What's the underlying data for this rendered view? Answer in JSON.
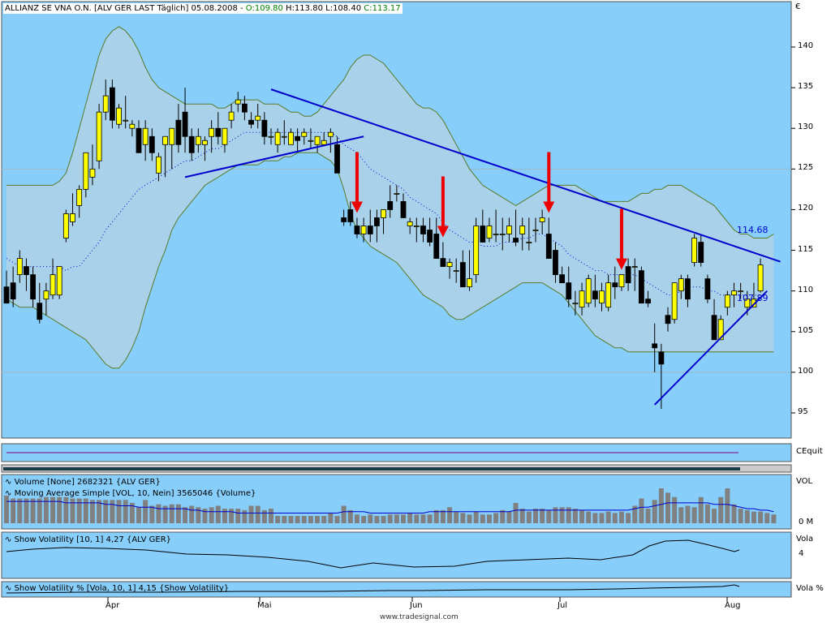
{
  "header": {
    "instrument": "ALLIANZ SE VNA O.N. [ALV GER LAST Täglich] 05.08.2008",
    "open": "O:109.80",
    "high": "H:113.80",
    "low": "L:108.40",
    "close": "C:113.17",
    "currency": "€"
  },
  "colors": {
    "background": "#87cefa",
    "band_fill": "#a9d2ea",
    "band_line": "#5a7a2a",
    "trendline": "#0000cc",
    "arrow": "#ee0000",
    "up_candle": "#ffff00",
    "down_candle": "#000000",
    "volume_bar": "#808080",
    "volume_ma": "#0000cc"
  },
  "price_panel": {
    "y_ticks": [
      "140",
      "135",
      "130",
      "125",
      "120",
      "115",
      "110",
      "105",
      "100",
      "95"
    ],
    "label_upper": "114.68",
    "label_lower": "107.89"
  },
  "cequity_panel": {
    "label": "CEquit"
  },
  "volume_panel": {
    "legend1": "Volume [None] 2682321 {ALV GER}",
    "legend2": "Moving Average Simple [VOL, 10, Nein] 3565046 {Volume}",
    "axis_label": "VOL",
    "axis_value": "0 M"
  },
  "volatility_panel": {
    "legend": "Show Volatility [10, 1] 4,27 {ALV GER}",
    "axis_label": "Vola",
    "axis_value": "4"
  },
  "volatility_pct_panel": {
    "legend": "Show Volatility % [Vola, 10, 1] 4,15 {Show Volatility}",
    "axis_label": "Vola %"
  },
  "x_axis": {
    "months": [
      "Apr",
      "Mai",
      "Jun",
      "Jul",
      "Aug"
    ]
  },
  "footer": "www.tradesignal.com",
  "chart_data": {
    "type": "candlestick",
    "title": "ALLIANZ SE VNA O.N. [ALV GER LAST Täglich] 05.08.2008",
    "ylim": [
      93,
      145
    ],
    "candles": [
      [
        110.5,
        112.5,
        108.5,
        108.5
      ],
      [
        111,
        113,
        108,
        109
      ],
      [
        112,
        115,
        111,
        114
      ],
      [
        113,
        114,
        110,
        112
      ],
      [
        112,
        113,
        108,
        109
      ],
      [
        108.5,
        111,
        106,
        106.5
      ],
      [
        109,
        111,
        107,
        110
      ],
      [
        109.5,
        114,
        109,
        112
      ],
      [
        109.5,
        113,
        109,
        113
      ],
      [
        116.5,
        120,
        116,
        119.5
      ],
      [
        118.5,
        122,
        118,
        119.5
      ],
      [
        120.5,
        123,
        119,
        122.5
      ],
      [
        122.5,
        127,
        121.5,
        127
      ],
      [
        124,
        128,
        123,
        125
      ],
      [
        126,
        133,
        125,
        132
      ],
      [
        132,
        136,
        131,
        134
      ],
      [
        135,
        136,
        130,
        131
      ],
      [
        130.5,
        133,
        130,
        132.5
      ],
      [
        131,
        134,
        130,
        131
      ],
      [
        130,
        131,
        129,
        130.5
      ],
      [
        130,
        131,
        127,
        127
      ],
      [
        128,
        131,
        126,
        130
      ],
      [
        129,
        130,
        126,
        127
      ],
      [
        124.5,
        127,
        123.5,
        126.5
      ],
      [
        128,
        129,
        124,
        129
      ],
      [
        128,
        130,
        125,
        130
      ],
      [
        131,
        133,
        127,
        128
      ],
      [
        132,
        135,
        127,
        129
      ],
      [
        129,
        130,
        126,
        127
      ],
      [
        128,
        130,
        127,
        129
      ],
      [
        128,
        129,
        126,
        128.5
      ],
      [
        129,
        131,
        127,
        130
      ],
      [
        130,
        132,
        128,
        129
      ],
      [
        128,
        130,
        127,
        130
      ],
      [
        131,
        133,
        130,
        132
      ],
      [
        133,
        134.5,
        132,
        133.5
      ],
      [
        133,
        134,
        131,
        132
      ],
      [
        131,
        132,
        130,
        130.5
      ],
      [
        131,
        133,
        130,
        131.5
      ],
      [
        131,
        132,
        128,
        129
      ],
      [
        129,
        130,
        128,
        129
      ],
      [
        128,
        130,
        127,
        129.5
      ],
      [
        129,
        131,
        128,
        129
      ],
      [
        128,
        130,
        128,
        129.5
      ],
      [
        129,
        130,
        127,
        128.5
      ],
      [
        129,
        130,
        128,
        129.5
      ],
      [
        128.5,
        130,
        127.5,
        128.5
      ],
      [
        128,
        129,
        127,
        129
      ],
      [
        128,
        129.5,
        128,
        128.5
      ],
      [
        129,
        130,
        127,
        129.5
      ],
      [
        128,
        129,
        125,
        124.5
      ],
      [
        119,
        120,
        118,
        118.5
      ],
      [
        120,
        121,
        118,
        118.5
      ],
      [
        118,
        119,
        116.5,
        117
      ],
      [
        117,
        119,
        116,
        118
      ],
      [
        118,
        120,
        116,
        117
      ],
      [
        119,
        120,
        116,
        118
      ],
      [
        119,
        120,
        117,
        120
      ],
      [
        121,
        123,
        119,
        120
      ],
      [
        122,
        123,
        121,
        122
      ],
      [
        121,
        122,
        119,
        119
      ],
      [
        118,
        119,
        117,
        118.5
      ],
      [
        118,
        119,
        116,
        118
      ],
      [
        118,
        119,
        116,
        117
      ],
      [
        117.5,
        119,
        115.5,
        116
      ],
      [
        117,
        119,
        114,
        114
      ],
      [
        114,
        116,
        113,
        113
      ],
      [
        113,
        114,
        111.5,
        113.5
      ],
      [
        112.5,
        114,
        111,
        112.5
      ],
      [
        113.5,
        115,
        110.5,
        110.5
      ],
      [
        110.5,
        115,
        110,
        111.5
      ],
      [
        112,
        119,
        111,
        118
      ],
      [
        118,
        120,
        116,
        116
      ],
      [
        116.5,
        119,
        116,
        118
      ],
      [
        117,
        120,
        116,
        117
      ],
      [
        117,
        119,
        115,
        117
      ],
      [
        117,
        119,
        116,
        118
      ],
      [
        116.5,
        120,
        115.5,
        116
      ],
      [
        117,
        119,
        115,
        118
      ],
      [
        116,
        119,
        115,
        116
      ],
      [
        117.5,
        119,
        116,
        117.5
      ],
      [
        118.5,
        120,
        117,
        119
      ],
      [
        117,
        119,
        114,
        114
      ],
      [
        115,
        116,
        111,
        112
      ],
      [
        112,
        113,
        111,
        111
      ],
      [
        111,
        113,
        108,
        109
      ],
      [
        108.5,
        110,
        107,
        108.5
      ],
      [
        108,
        111,
        107,
        110
      ],
      [
        108.5,
        112,
        108,
        111.5
      ],
      [
        110,
        112,
        108,
        109
      ],
      [
        108.5,
        111,
        107.5,
        110
      ],
      [
        108,
        112,
        107.5,
        111
      ],
      [
        111,
        113,
        109,
        110.5
      ],
      [
        110.5,
        112,
        110,
        112
      ],
      [
        113,
        114,
        110,
        111
      ],
      [
        113,
        114,
        110,
        113
      ],
      [
        112.5,
        113,
        109,
        108.5
      ],
      [
        109,
        110,
        108,
        108.5
      ],
      [
        103.5,
        106,
        100,
        103
      ],
      [
        102.5,
        103.5,
        95.5,
        101
      ],
      [
        107,
        108,
        105,
        106
      ],
      [
        106.5,
        108,
        106,
        111
      ],
      [
        110,
        112,
        109,
        111.5
      ],
      [
        111.5,
        112,
        108,
        109
      ],
      [
        113.5,
        117,
        113,
        116.5
      ],
      [
        116,
        117,
        113,
        113.5
      ],
      [
        111.5,
        112,
        108.5,
        109
      ],
      [
        107,
        109,
        104,
        104
      ],
      [
        104,
        107,
        104,
        106.5
      ],
      [
        108,
        110,
        107,
        109.5
      ],
      [
        109.5,
        111,
        108,
        110
      ],
      [
        110,
        111,
        109,
        110
      ],
      [
        108,
        110,
        107,
        109
      ],
      [
        108,
        111,
        108,
        109
      ],
      [
        110,
        114,
        109.8,
        113.2
      ]
    ],
    "candle_format": [
      "open",
      "high",
      "low",
      "close"
    ],
    "middle_band": [
      114,
      113.5,
      113,
      113,
      113,
      113,
      113,
      113,
      113,
      112.5,
      113,
      113,
      114,
      115,
      116,
      117.5,
      118.5,
      119.5,
      120.5,
      121.5,
      122.5,
      123,
      123.5,
      124,
      124.5,
      125,
      125.5,
      126,
      126,
      126.5,
      127,
      127.5,
      127.5,
      128,
      128.5,
      129,
      129.5,
      129.5,
      129.5,
      129.5,
      129.5,
      129.5,
      129.5,
      129.5,
      129.5,
      129.5,
      129.5,
      129.5,
      129.5,
      129.5,
      129,
      128,
      127.5,
      127,
      126,
      125,
      124.5,
      124,
      123.5,
      123,
      122.5,
      121.5,
      121,
      120.5,
      120,
      119.5,
      118.5,
      117.5,
      117,
      116.5,
      116,
      116,
      115.5,
      115.5,
      115.5,
      116,
      116,
      116,
      116.5,
      116.5,
      117,
      117,
      116.5,
      116,
      115.5,
      114.5,
      114,
      113.5,
      113,
      112.5,
      112.5,
      112,
      112,
      112,
      112,
      112,
      111.5,
      111,
      110.5,
      110,
      109.5,
      109.5,
      110,
      110.5,
      110.5,
      110.5,
      110,
      110,
      109.5,
      109.5,
      109.5,
      109.5,
      109.5,
      109.5,
      109.5
    ],
    "upper_band": [
      123,
      123,
      123,
      123,
      123,
      123,
      123,
      123,
      123.5,
      124.5,
      127,
      130,
      133,
      136,
      139,
      141,
      142,
      142.5,
      142,
      141,
      139.5,
      137.5,
      136,
      135,
      134.5,
      134,
      133.5,
      133,
      133,
      133,
      133,
      133,
      132.5,
      132.5,
      133,
      133.5,
      133.5,
      133.5,
      133.5,
      133,
      133,
      133,
      132.5,
      132,
      132,
      131.5,
      131.5,
      132,
      133,
      134,
      135,
      136,
      137.5,
      138.5,
      139,
      139,
      138.5,
      138,
      137,
      136,
      135,
      134,
      133,
      132.5,
      132.5,
      132,
      131,
      129.5,
      128,
      126.5,
      125,
      124,
      123,
      122.5,
      122,
      121.5,
      121,
      120.5,
      121,
      121.5,
      122,
      122.5,
      123,
      123,
      123,
      123,
      123,
      122.5,
      122,
      121.5,
      121,
      121,
      121,
      121,
      121,
      121.5,
      122,
      122,
      122.5,
      122.5,
      123,
      123,
      123,
      122.5,
      122,
      121.5,
      121,
      120.5,
      119.5,
      118.5,
      117.5,
      117,
      117,
      116.5,
      116.5,
      116.5,
      117
    ],
    "lower_band": [
      109,
      108.5,
      108,
      108,
      108,
      107.5,
      107,
      106.5,
      106,
      105.5,
      105,
      104.5,
      104,
      103,
      102,
      101,
      100.5,
      100.5,
      101.5,
      103,
      105,
      108,
      110.5,
      113,
      115,
      117.5,
      119,
      120,
      121,
      122,
      123,
      123.5,
      124,
      124.5,
      125,
      125.5,
      125.5,
      125.5,
      125.5,
      126,
      126,
      126,
      126.5,
      126.5,
      127,
      127,
      127,
      127,
      126.5,
      126,
      125,
      122.5,
      119.5,
      117.5,
      116.5,
      115.5,
      115,
      114.5,
      114,
      113.5,
      112.5,
      111.5,
      110.5,
      109.5,
      109,
      108.5,
      108,
      107,
      106.5,
      106.5,
      107,
      107.5,
      108,
      108.5,
      109,
      109.5,
      110,
      110.5,
      111,
      111,
      111,
      111,
      110.5,
      110,
      109.5,
      108.5,
      107.5,
      106.5,
      105.5,
      104.5,
      104,
      103.5,
      103,
      103,
      102.5,
      102.5,
      102.5,
      102.5,
      102.5,
      102.5,
      102.5,
      102.5,
      102.5,
      102.5,
      102.5,
      102.5,
      102.5,
      102.5,
      102.5,
      102.5,
      102.5,
      102.5,
      102.5,
      102.5,
      102.5,
      102.5,
      102.5
    ],
    "trendlines": [
      {
        "from": [
          27,
          124
        ],
        "to": [
          54,
          129
        ]
      },
      {
        "from": [
          40,
          134.8
        ],
        "to": [
          117,
          113.6
        ]
      },
      {
        "from": [
          98,
          96
        ],
        "to": [
          115,
          110
        ]
      }
    ],
    "arrows_at": [
      53,
      66,
      82,
      93
    ],
    "volume": [
      1.9,
      1.7,
      1.7,
      1.7,
      1.7,
      1.7,
      1.8,
      1.8,
      1.8,
      1.8,
      1.7,
      1.7,
      1.7,
      1.6,
      1.6,
      1.6,
      1.6,
      1.6,
      1.6,
      1.4,
      1.1,
      1.6,
      1.2,
      1.3,
      1.2,
      1.3,
      1.3,
      1.1,
      1.2,
      1.1,
      1.0,
      1.1,
      1.2,
      1.0,
      1.0,
      1.0,
      0.9,
      1.2,
      1.2,
      0.9,
      1.0,
      0.5,
      0.5,
      0.5,
      0.5,
      0.5,
      0.5,
      0.5,
      0.5,
      0.7,
      0.5,
      1.2,
      0.9,
      0.6,
      0.5,
      0.6,
      0.5,
      0.5,
      0.6,
      0.6,
      0.6,
      0.7,
      0.6,
      0.6,
      0.6,
      0.9,
      0.9,
      1.1,
      0.8,
      0.7,
      0.6,
      0.8,
      0.6,
      0.6,
      0.7,
      0.9,
      0.8,
      1.4,
      1.0,
      0.8,
      1.0,
      1.0,
      0.9,
      1.1,
      1.1,
      1.1,
      1.0,
      0.9,
      0.8,
      0.7,
      0.7,
      0.8,
      0.7,
      0.8,
      0.7,
      1.2,
      1.7,
      1.0,
      1.6,
      2.4,
      2.1,
      1.8,
      1.1,
      1.2,
      1.1,
      1.8,
      1.3,
      1.0,
      1.8,
      2.4,
      1.3,
      1.0,
      0.9,
      0.8,
      0.8,
      0.7,
      0.6
    ],
    "volume_ma": [
      1.5,
      1.5,
      1.5,
      1.5,
      1.5,
      1.5,
      1.5,
      1.5,
      1.5,
      1.4,
      1.4,
      1.4,
      1.4,
      1.4,
      1.4,
      1.3,
      1.3,
      1.2,
      1.2,
      1.2,
      1.1,
      1.1,
      1.1,
      1.0,
      1.0,
      1.0,
      1.0,
      1.0,
      0.9,
      0.9,
      0.8,
      0.8,
      0.8,
      0.8,
      0.8,
      0.7,
      0.7,
      0.7,
      0.7,
      0.7,
      0.7,
      0.7,
      0.7,
      0.7,
      0.7,
      0.7,
      0.7,
      0.7,
      0.7,
      0.7,
      0.7,
      0.8,
      0.8,
      0.8,
      0.8,
      0.7,
      0.7,
      0.7,
      0.7,
      0.7,
      0.7,
      0.7,
      0.7,
      0.7,
      0.8,
      0.8,
      0.8,
      0.8,
      0.8,
      0.8,
      0.8,
      0.8,
      0.8,
      0.8,
      0.8,
      0.8,
      0.8,
      0.9,
      0.9,
      0.9,
      0.9,
      0.9,
      0.9,
      0.9,
      0.9,
      0.9,
      0.9,
      0.9,
      0.9,
      0.9,
      0.9,
      0.9,
      0.9,
      0.9,
      0.9,
      1.0,
      1.1,
      1.1,
      1.2,
      1.3,
      1.4,
      1.4,
      1.4,
      1.4,
      1.4,
      1.4,
      1.4,
      1.3,
      1.3,
      1.3,
      1.2,
      1.1,
      1.0,
      1.0,
      0.9,
      0.9,
      0.8
    ]
  }
}
